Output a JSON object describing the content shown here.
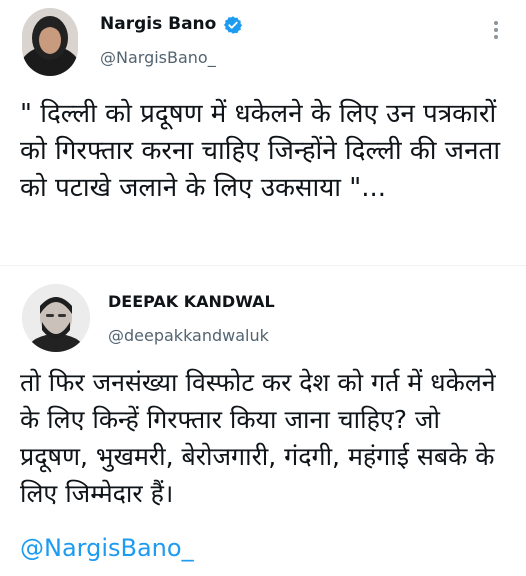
{
  "tweet_1": {
    "name": "Nargis Bano",
    "handle": "@NargisBano_",
    "text": "\" दिल्ली को प्रदूषण में धकेलने के लिए उन पत्रकारों को गिरफ्तार करना चाहिए जिन्होंने दिल्ली की जनता को पटाखे जलाने के लिए उकसाया \"..."
  },
  "tweet_2": {
    "name": "DEEPAK KANDWAL",
    "handle": "@deepakkandwaluk",
    "text": "तो फिर जनसंख्या विस्फोट कर देश को गर्त में धकेलने के लिए किन्हें गिरफ्तार किया जाना चाहिए? जो प्रदूषण, भुखमरी, बेरोजगारी, गंदगी, महंगाई सबके के लिए जिम्मेदार हैं।",
    "mention": "@NargisBano_"
  },
  "colors": {
    "verified": "#1d9bf0",
    "mention": "#1d9bf0",
    "handle": "#536471"
  },
  "icons": {
    "verified": "verified-badge-icon",
    "more": "more-options-icon"
  }
}
